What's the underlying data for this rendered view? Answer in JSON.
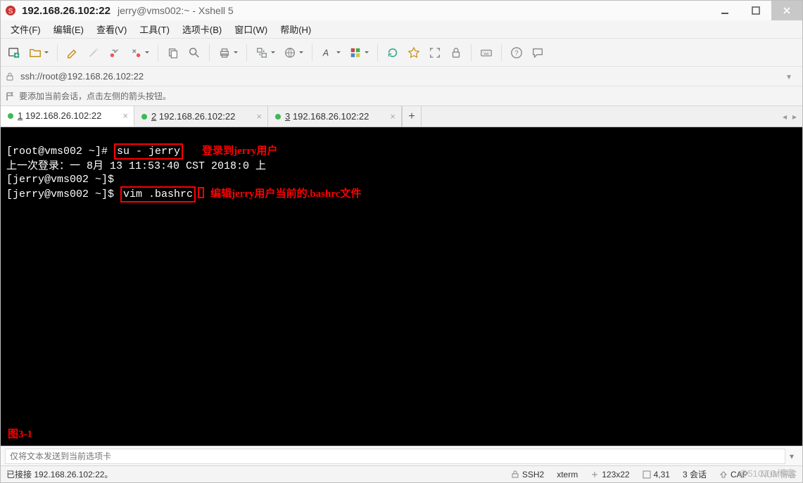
{
  "window": {
    "title_host": "192.168.26.102:22",
    "title_rest": "jerry@vms002:~ - Xshell 5"
  },
  "menu": {
    "file": "文件(F)",
    "edit": "编辑(E)",
    "view": "查看(V)",
    "tools": "工具(T)",
    "tabs": "选项卡(B)",
    "window": "窗口(W)",
    "help": "帮助(H)"
  },
  "toolbar_icons": {
    "new": "new-window-icon",
    "open": "open-folder-icon",
    "pencil": "edit-icon",
    "wand": "magic-wand-icon",
    "reconnect": "reconnect-icon",
    "disconnect": "disconnect-icon",
    "copy": "copy-icon",
    "search": "search-icon",
    "print": "print-icon",
    "transfer": "file-transfer-icon",
    "globe": "globe-icon",
    "font": "font-icon",
    "palette": "color-scheme-icon",
    "refresh": "refresh-icon",
    "star": "favorite-icon",
    "fullscreen": "fullscreen-icon",
    "lock": "lock-icon",
    "keyboard": "keyboard-icon",
    "help": "help-icon",
    "chat": "chat-icon"
  },
  "address": {
    "value": "ssh://root@192.168.26.102:22"
  },
  "hint": {
    "text": "要添加当前会话，点击左侧的箭头按钮。"
  },
  "tabs": [
    {
      "num": "1",
      "label": "192.168.26.102:22",
      "active": true
    },
    {
      "num": "2",
      "label": "192.168.26.102:22",
      "active": false
    },
    {
      "num": "3",
      "label": "192.168.26.102:22",
      "active": false
    }
  ],
  "terminal": {
    "line1_prompt": "[root@vms002 ~]#",
    "line1_cmd": "su - jerry",
    "line1_ann": "登录到jerry用户",
    "line2": "上一次登录：一 8月 13 11:53:40 CST 2018:0 上",
    "line3": "[jerry@vms002 ~]$",
    "line4_prompt": "[jerry@vms002 ~]$",
    "line4_cmd": "vim .bashrc",
    "line4_ann": "编辑jerry用户当前的.bashrc文件",
    "figure_label": "图3-1"
  },
  "sendbar": {
    "placeholder": "仅将文本发送到当前选项卡"
  },
  "status": {
    "connected": "已接接 192.168.26.102:22。",
    "protocol": "SSH2",
    "term": "xterm",
    "size": "123x22",
    "pos": "4,31",
    "sessions": "3 会话",
    "caps": "CAP",
    "num": "NUM博客"
  },
  "watermark": "@51CTO博客"
}
